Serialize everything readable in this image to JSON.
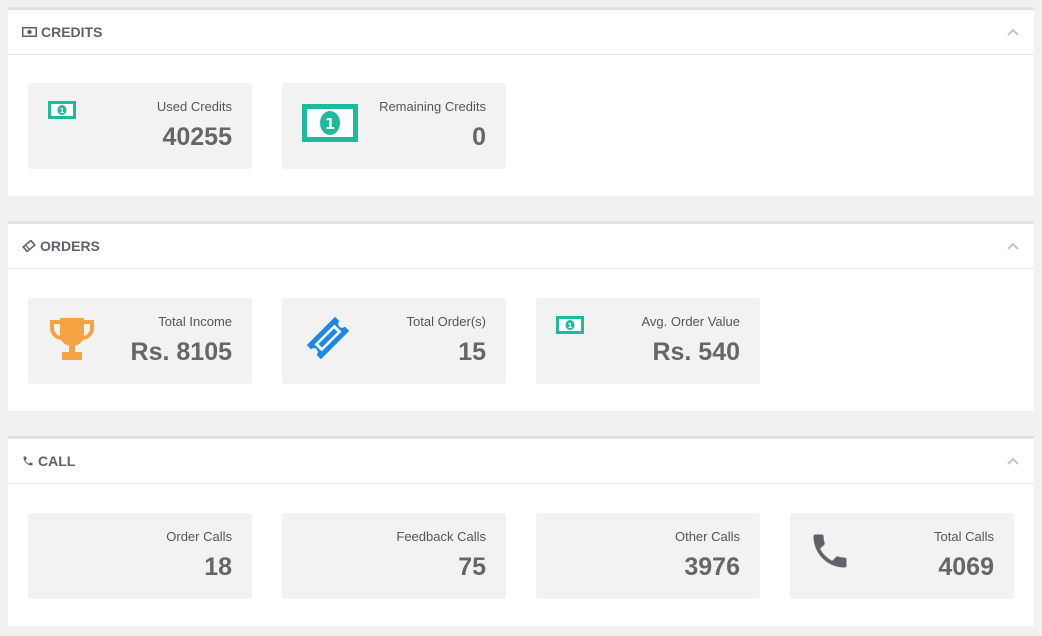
{
  "colors": {
    "green": "#1abc9c",
    "orange": "#f5a342",
    "blue": "#1e88e5",
    "gray_icon": "#5f6368"
  },
  "credits": {
    "title": "CREDITS",
    "title_icon": "money-icon",
    "cards": [
      {
        "label": "Used Credits",
        "value": "40255",
        "icon": "money-icon"
      },
      {
        "label": "Remaining Credits",
        "value": "0",
        "icon": "money-icon"
      }
    ]
  },
  "orders": {
    "title": "ORDERS",
    "title_icon": "ticket-icon",
    "cards": [
      {
        "label": "Total Income",
        "value": "Rs. 8105",
        "icon": "trophy-icon"
      },
      {
        "label": "Total Order(s)",
        "value": "15",
        "icon": "ticket-icon"
      },
      {
        "label": "Avg. Order Value",
        "value": "Rs. 540",
        "icon": "money-icon"
      }
    ]
  },
  "call": {
    "title": "CALL",
    "title_icon": "phone-icon",
    "cards": [
      {
        "label": "Order Calls",
        "value": "18"
      },
      {
        "label": "Feedback Calls",
        "value": "75"
      },
      {
        "label": "Other Calls",
        "value": "3976"
      },
      {
        "label": "Total Calls",
        "value": "4069",
        "icon": "phone-icon"
      }
    ]
  }
}
